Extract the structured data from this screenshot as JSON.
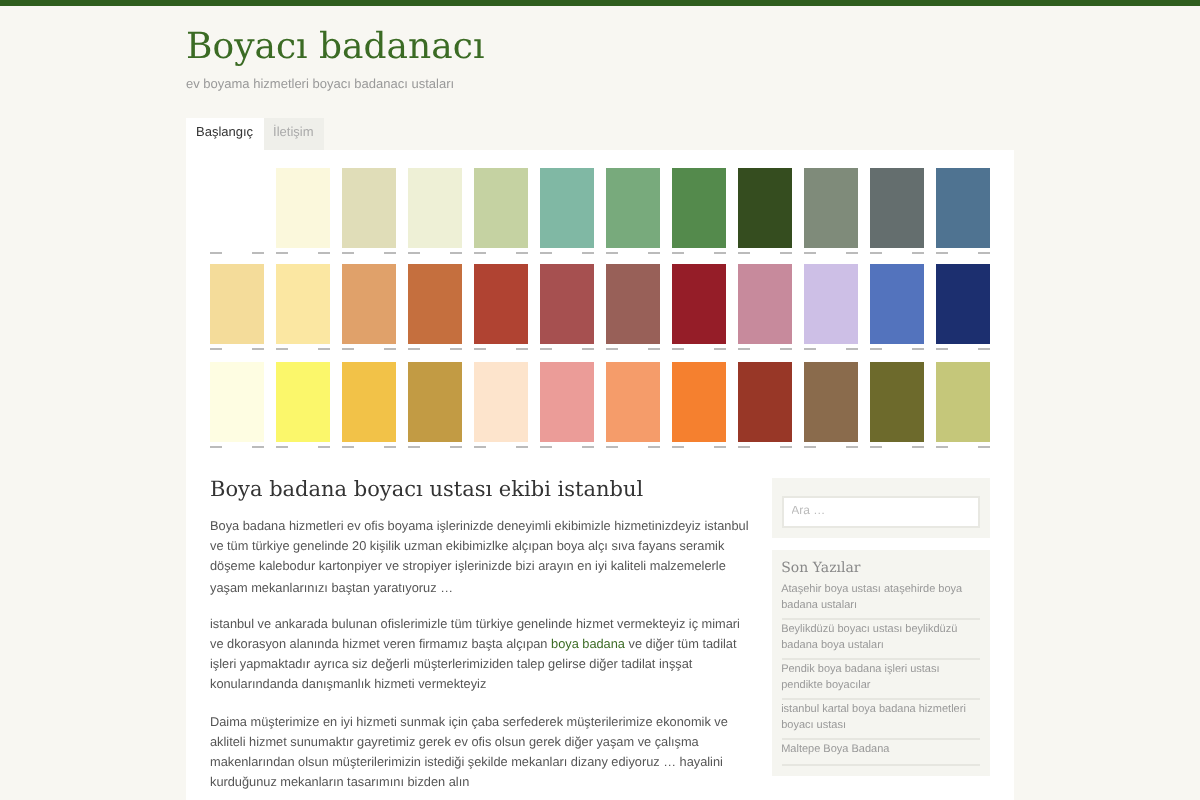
{
  "site": {
    "title": "Boyacı badanacı",
    "tagline": "ev boyama hizmetleri boyacı badanacı ustaları"
  },
  "tabs": [
    {
      "label": "Başlangıç",
      "selected": true
    },
    {
      "label": "İletişim",
      "selected": false
    }
  ],
  "article": {
    "title": "Boya badana boyacı ustası ekibi istanbul",
    "paragraphs": [
      [
        {
          "text": "Boya badana hizmetleri ev ofis boyama işlerinizde deneyimli ekibimizle hizmetinizdeyiz istanbul ve tüm türkiye genelinde 20 kişilik uzman ekibimizlke alçıpan boya alçı sıva  fayans seramik döşeme kalebodur kartonpiyer ve stropiyer işlerinizde bizi arayın en iyi kaliteli malzemelerle yaşam mekanlarınızı  baştan yaratıyoruz …",
          "link": false
        }
      ],
      [
        {
          "text": "istanbul ve ankarada bulunan ofislerimizle tüm türkiye genelinde hizmet vermekteyiz  iç mimari ve dkorasyon alanında  hizmet veren firmamız başta alçıpan ",
          "link": false
        },
        {
          "text": "boya badana",
          "link": true
        },
        {
          "text": " ve diğer tüm tadilat işleri yapmaktadır  ayrıca  siz değerli müşterlerimiziden talep gelirse diğer tadilat inşşat konularındanda danışmanlık hizmeti vermekteyiz",
          "link": false
        }
      ],
      [
        {
          "text": "Daima  müşterimize en iyi hizmeti sunmak için çaba serfederek müşterilerimize ekonomik ve akliteli hizmet sunumaktır gayretimiz  gerek ev  ofis olsun gerek diğer yaşam ve çalışma makenlarından olsun müşterilerimizin istediği şekilde mekanları dizany ediyoruz … hayalini kurduğunuz mekanların tasarımını bizden alın",
          "link": false
        }
      ]
    ]
  },
  "sidebar": {
    "search": {
      "placeholder": "Ara …"
    },
    "recent_posts": {
      "title": "Son Yazılar",
      "items": [
        "Ataşehir boya ustası ataşehirde boya badana ustaları",
        "Beylikdüzü boyacı ustası beylikdüzü badana boya ustaları",
        "Pendik boya badana işleri ustası pendikte boyacılar",
        "istanbul kartal boya badana hizmetleri boyacı ustası",
        "Maltepe Boya Badana"
      ]
    }
  }
}
